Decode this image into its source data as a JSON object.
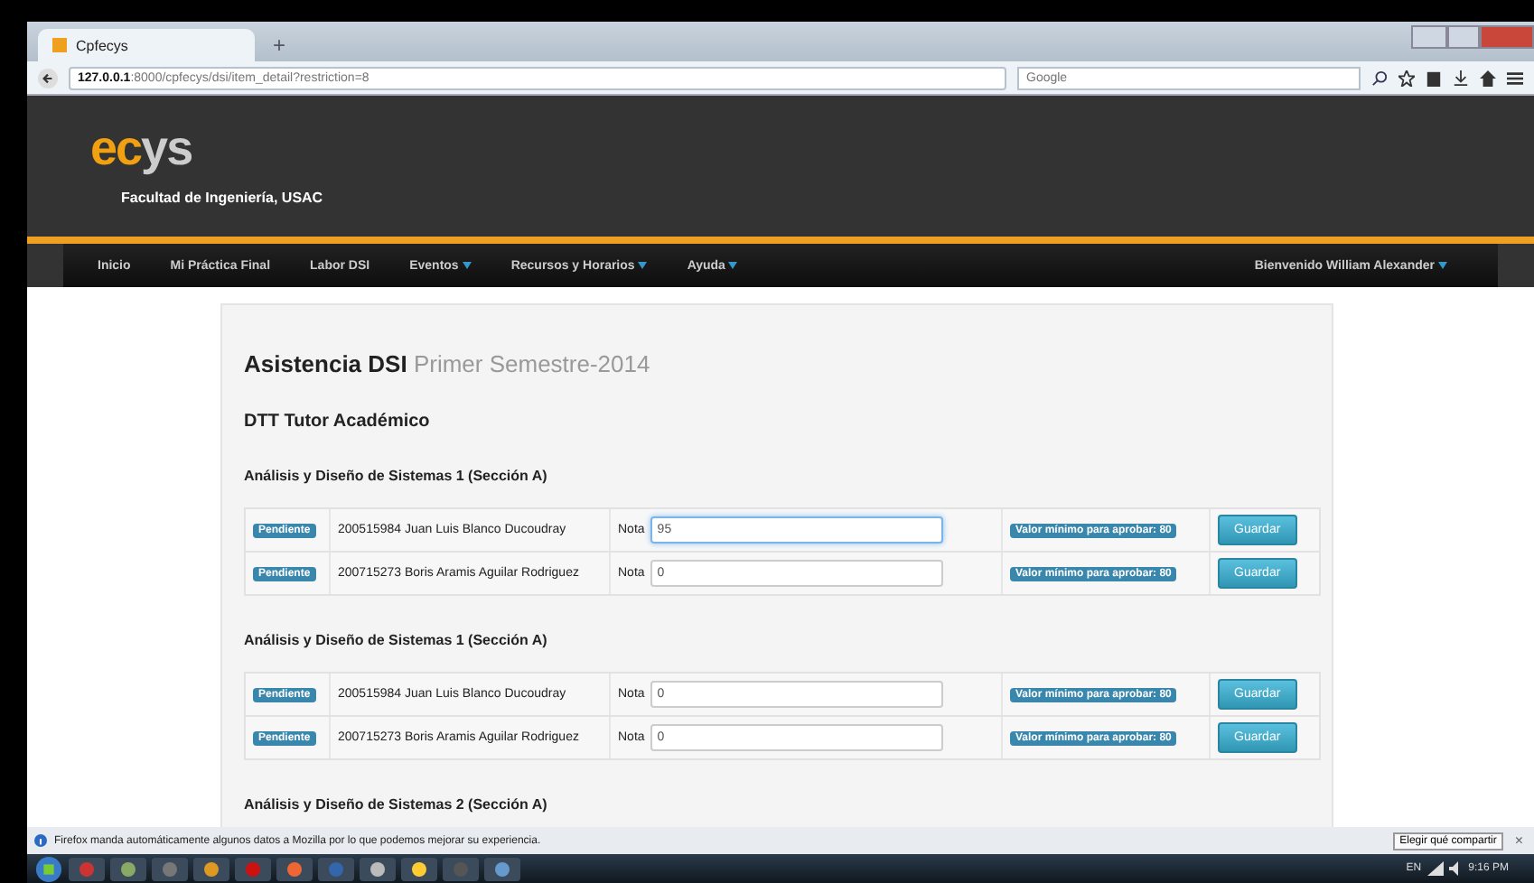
{
  "browser": {
    "tab": {
      "title": "Cpfecys",
      "selected": true
    },
    "new_tab": "+",
    "url": "**127.0.0.1**:8000/cpfecys/dsi/item_detail?restriction=8",
    "search": {
      "placeholder": "Google"
    }
  },
  "header": {
    "logo_accent": "ec",
    "logo_rest": "ys",
    "subtitle": "Facultad de Ingeniería, USAC"
  },
  "nav": {
    "items": [
      {
        "label": "Inicio",
        "dropdown": false
      },
      {
        "label": "Mi Práctica Final",
        "dropdown": false
      },
      {
        "label": "Labor DSI",
        "dropdown": false
      },
      {
        "label": "Eventos",
        "dropdown": true
      },
      {
        "label": "Recursos y Horarios",
        "dropdown": true
      },
      {
        "label": "Ayuda",
        "dropdown": true
      }
    ],
    "user": {
      "label": "Bienvenido William Alexander",
      "dropdown": true
    }
  },
  "page": {
    "title": "Asistencia DSI",
    "subtitle": "Primer Semestre-2014",
    "role": "DTT Tutor Académico",
    "sections": [
      {
        "title": "Análisis y Diseño de Sistemas 1 (Sección A)",
        "rows": [
          {
            "status": "Pendiente",
            "student": "200515984 Juan Luis Blanco Ducoudray",
            "label": "Nota",
            "value": "95",
            "focused": true,
            "minimum": "Valor mínimo para aprobar: 80",
            "button": "Guardar"
          },
          {
            "status": "Pendiente",
            "student": "200715273 Boris Aramis Aguilar Rodriguez",
            "label": "Nota",
            "value": "0",
            "focused": false,
            "minimum": "Valor mínimo para aprobar: 80",
            "button": "Guardar"
          }
        ]
      },
      {
        "title": "Análisis y Diseño de Sistemas 1 (Sección A)",
        "rows": [
          {
            "status": "Pendiente",
            "student": "200515984 Juan Luis Blanco Ducoudray",
            "label": "Nota",
            "value": "0",
            "focused": false,
            "minimum": "Valor mínimo para aprobar: 80",
            "button": "Guardar"
          },
          {
            "status": "Pendiente",
            "student": "200715273 Boris Aramis Aguilar Rodriguez",
            "label": "Nota",
            "value": "0",
            "focused": false,
            "minimum": "Valor mínimo para aprobar: 80",
            "button": "Guardar"
          }
        ]
      },
      {
        "title": "Análisis y Diseño de Sistemas 2 (Sección A)"
      }
    ]
  },
  "notification": {
    "text": "Firefox manda automáticamente algunos datos a Mozilla por lo que podemos mejorar su experiencia.",
    "button": "Elegir qué compartir",
    "close": "×"
  },
  "taskbar": {
    "language": "EN",
    "time": "9:16 PM"
  }
}
